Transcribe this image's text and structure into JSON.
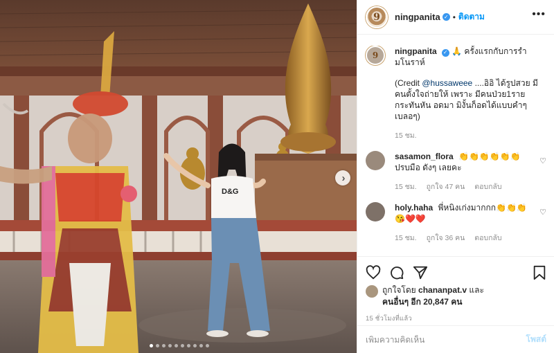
{
  "post": {
    "username": "ningpanita",
    "follow_label": "ติดตาม",
    "more_icon": "ellipsis-icon",
    "carousel": {
      "total": 10,
      "active": 0
    }
  },
  "caption": {
    "username": "ningpanita",
    "emoji": "🙏",
    "text": "ครั้งแรกกับการรำมโนราห์",
    "credit_open": "(Credit ",
    "credit_mention": "@hussaweee",
    "credit_body": " ....อิอิ ได้รูปสวย มีคนตั้งใจถ่ายให้ เพราะ มีคนป่วย1ราย กระทันหัน อดมา มิงั้นก็อดได้แบบคำๆ เบลอๆ)",
    "time": "15 ชม."
  },
  "comments": [
    {
      "username": "sasamon_flora",
      "text": "👏👏👏👏👏👏 ปรบมือ ดังๆ เลยคะ",
      "time": "15 ชม.",
      "likes": "ถูกใจ 47 คน",
      "reply": "ตอบกลับ"
    },
    {
      "username": "holy.haha",
      "text": "พี่หนิงเก่งมากกก👏👏👏😘❤️❤️",
      "time": "15 ชม.",
      "likes": "ถูกใจ 36 คน",
      "reply": "ตอบกลับ"
    }
  ],
  "likes": {
    "prefix": "ถูกใจโดย",
    "user": "chananpat.v",
    "connector": "และ",
    "others": "คนอื่นๆ อีก 20,847 คน"
  },
  "timestamp": "15 ชั่วโมงที่แล้ว",
  "comment_input": {
    "placeholder": "เพิ่มความคิดเห็น",
    "post_label": "โพสต์"
  },
  "colors": {
    "link_blue": "#0095f6",
    "verified_blue": "#3897f0",
    "muted": "#8e8e8e",
    "post_disabled": "#b2dffc"
  }
}
